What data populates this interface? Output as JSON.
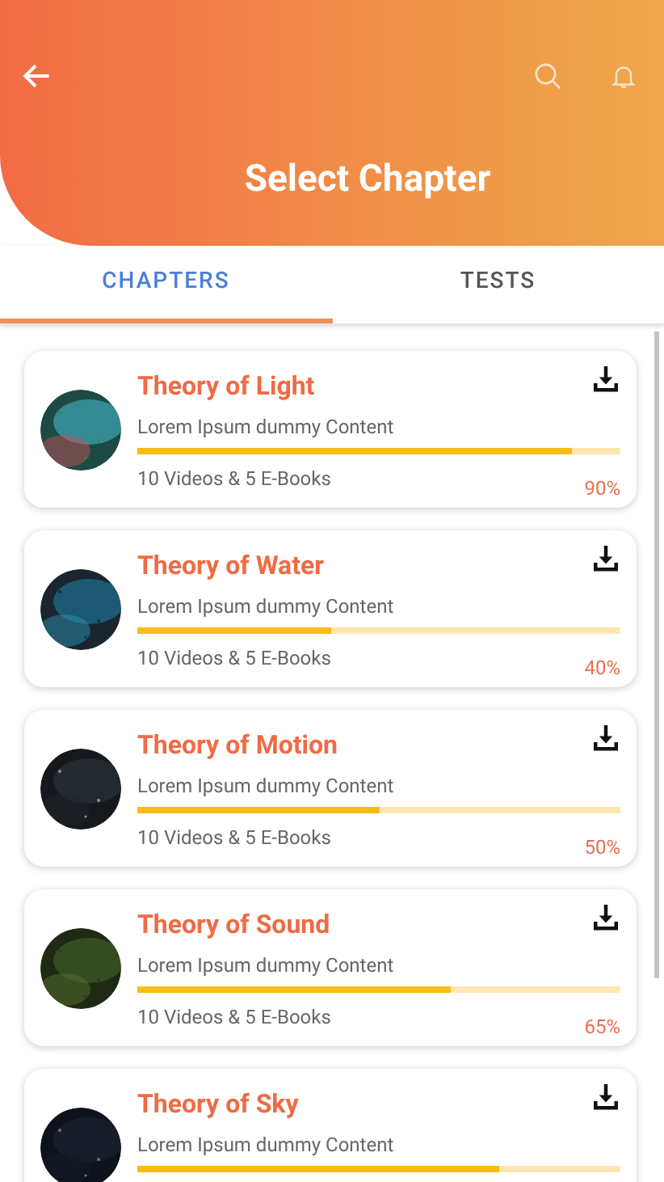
{
  "header": {
    "title": "Select Chapter"
  },
  "tabs": [
    {
      "label": "CHAPTERS",
      "selected": true
    },
    {
      "label": "TESTS",
      "selected": false
    }
  ],
  "chapters": [
    {
      "title": "Theory of Light",
      "subtitle": "Lorem Ipsum dummy Content",
      "level": 0.9,
      "meta": "10 Videos & 5 E-Books",
      "percent": "90%"
    },
    {
      "title": "Theory of Water",
      "subtitle": "Lorem Ipsum dummy Content",
      "level": 0.4,
      "meta": "10 Videos & 5 E-Books",
      "percent": "40%"
    },
    {
      "title": "Theory of Motion",
      "subtitle": "Lorem Ipsum dummy Content",
      "level": 0.5,
      "meta": "10 Videos & 5 E-Books",
      "percent": "50%"
    },
    {
      "title": "Theory of Sound",
      "subtitle": "Lorem Ipsum dummy Content",
      "level": 0.65,
      "meta": "10 Videos & 5 E-Books",
      "percent": "65%"
    },
    {
      "title": "Theory of Sky",
      "subtitle": "Lorem Ipsum dummy Content",
      "level": 0.75
    }
  ]
}
